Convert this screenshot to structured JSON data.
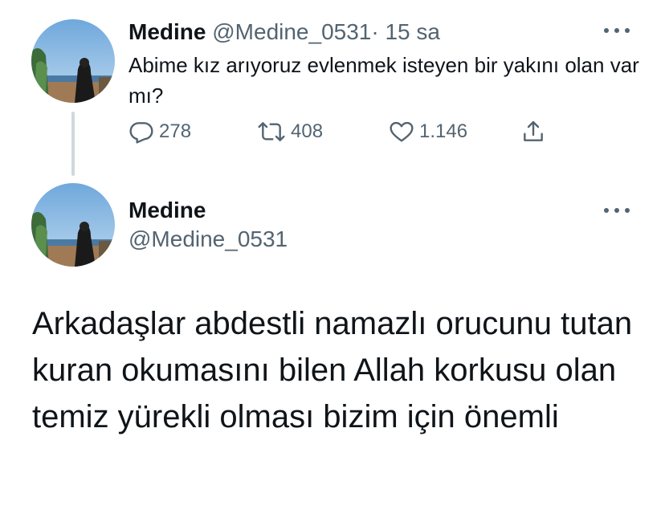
{
  "tweet1": {
    "name": "Medine",
    "handle": "@Medine_0531",
    "separator": "·",
    "time": "15 sa",
    "text": "Abime kız arıyoruz evlenmek isteyen bir yakını olan var mı?",
    "actions": {
      "reply_icon": "reply-icon",
      "reply_count": "278",
      "retweet_icon": "retweet-icon",
      "retweet_count": "408",
      "like_icon": "heart-icon",
      "like_count": "1.146",
      "share_icon": "share-icon"
    }
  },
  "tweet2": {
    "name": "Medine",
    "handle": "@Medine_0531",
    "text": "Arkadaşlar abdestli namazlı orucunu tutan kuran okumasını bilen Allah korkusu olan temiz yürekli olması bizim için önemli"
  },
  "colors": {
    "text_primary": "#0f1419",
    "text_secondary": "#536471",
    "thread_line": "#cfd9de",
    "background": "#ffffff"
  }
}
